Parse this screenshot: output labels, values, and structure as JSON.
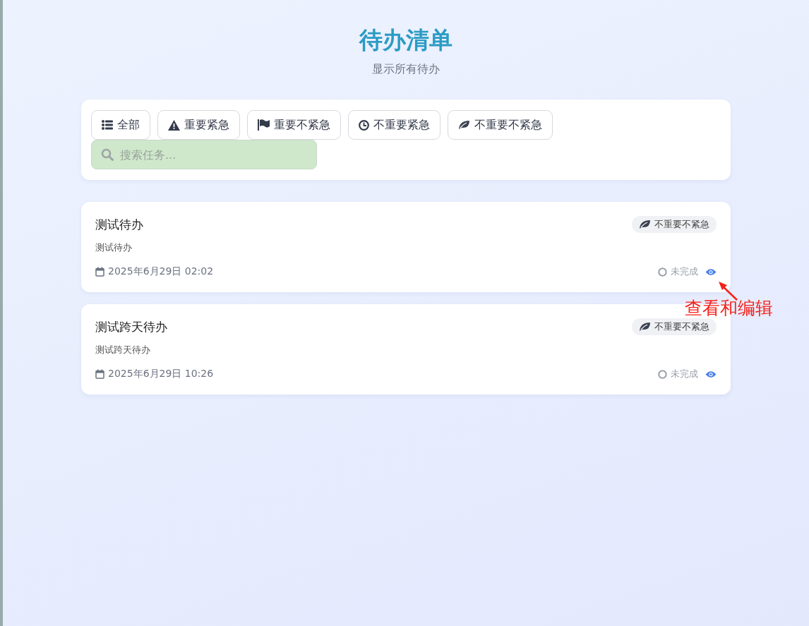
{
  "header": {
    "title": "待办清单",
    "subtitle": "显示所有待办"
  },
  "filters": [
    {
      "kind": "all",
      "label": "全部",
      "selected": false
    },
    {
      "kind": "urgent-important",
      "label": "重要紧急",
      "selected": false
    },
    {
      "kind": "important",
      "label": "重要不紧急",
      "selected": false
    },
    {
      "kind": "urgent",
      "label": "不重要紧急",
      "selected": false
    },
    {
      "kind": "neither",
      "label": "不重要不紧急",
      "selected": false
    }
  ],
  "search": {
    "placeholder": "搜索任务..."
  },
  "tasks": [
    {
      "title": "测试待办",
      "description": "测试待办",
      "date": "2025年6月29日 02:02",
      "priority": {
        "kind": "neither",
        "label": "不重要不紧急"
      },
      "status": "未完成",
      "completed": false
    },
    {
      "title": "测试跨天待办",
      "description": "测试跨天待办",
      "date": "2025年6月29日 10:26",
      "priority": {
        "kind": "neither",
        "label": "不重要不紧急"
      },
      "status": "未完成",
      "completed": false
    }
  ],
  "annotation": {
    "text": "查看和编辑"
  }
}
